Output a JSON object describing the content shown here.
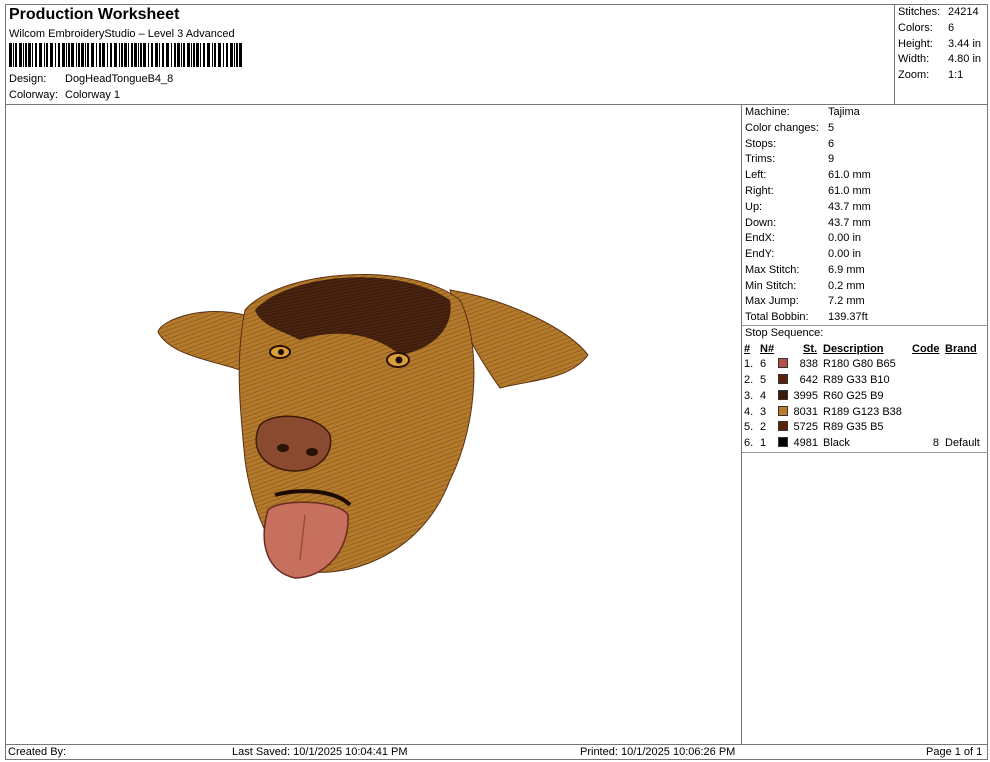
{
  "header": {
    "title": "Production Worksheet",
    "subtitle": "Wilcom EmbroideryStudio – Level 3 Advanced",
    "design_label": "Design:",
    "design_value": "DogHeadTongueB4_8",
    "colorway_label": "Colorway:",
    "colorway_value": "Colorway 1"
  },
  "summary": {
    "stitches_label": "Stitches:",
    "stitches_value": "24214",
    "colors_label": "Colors:",
    "colors_value": "6",
    "height_label": "Height:",
    "height_value": "3.44 in",
    "width_label": "Width:",
    "width_value": "4.80 in",
    "zoom_label": "Zoom:",
    "zoom_value": "1:1"
  },
  "machine_info": [
    {
      "label": "Machine:",
      "value": "Tajima"
    },
    {
      "label": "Color changes:",
      "value": "5"
    },
    {
      "label": "Stops:",
      "value": "6"
    },
    {
      "label": "Trims:",
      "value": "9"
    },
    {
      "label": "Left:",
      "value": "61.0 mm"
    },
    {
      "label": "Right:",
      "value": "61.0 mm"
    },
    {
      "label": "Up:",
      "value": "43.7 mm"
    },
    {
      "label": "Down:",
      "value": "43.7 mm"
    },
    {
      "label": "EndX:",
      "value": "0.00 in"
    },
    {
      "label": "EndY:",
      "value": "0.00 in"
    },
    {
      "label": "Max Stitch:",
      "value": "6.9 mm"
    },
    {
      "label": "Min Stitch:",
      "value": "0.2 mm"
    },
    {
      "label": "Max Jump:",
      "value": "7.2 mm"
    },
    {
      "label": "Total Bobbin:",
      "value": "139.37ft"
    }
  ],
  "stop_sequence": {
    "title": "Stop Sequence:",
    "columns": {
      "num": "#",
      "n": "N#",
      "st": "St.",
      "desc": "Description",
      "code": "Code",
      "brand": "Brand"
    },
    "rows": [
      {
        "num": "1.",
        "n": "6",
        "color": "#b4504a",
        "st": "838",
        "desc": "R180 G80 B65",
        "code": "",
        "brand": ""
      },
      {
        "num": "2.",
        "n": "5",
        "color": "#59210a",
        "st": "642",
        "desc": "R89 G33 B10",
        "code": "",
        "brand": ""
      },
      {
        "num": "3.",
        "n": "4",
        "color": "#3c1909",
        "st": "3995",
        "desc": "R60 G25 B9",
        "code": "",
        "brand": ""
      },
      {
        "num": "4.",
        "n": "3",
        "color": "#bd7b26",
        "st": "8031",
        "desc": "R189 G123 B38",
        "code": "",
        "brand": ""
      },
      {
        "num": "5.",
        "n": "2",
        "color": "#592305",
        "st": "5725",
        "desc": "R89 G35 B5",
        "code": "",
        "brand": ""
      },
      {
        "num": "6.",
        "n": "1",
        "color": "#000000",
        "st": "4981",
        "desc": "Black",
        "code": "8",
        "brand": "Default"
      }
    ]
  },
  "footer": {
    "created_by": "Created By:",
    "last_saved": "Last Saved: 10/1/2025 10:04:41 PM",
    "printed": "Printed: 10/1/2025 10:06:26 PM",
    "page": "Page 1 of 1"
  }
}
